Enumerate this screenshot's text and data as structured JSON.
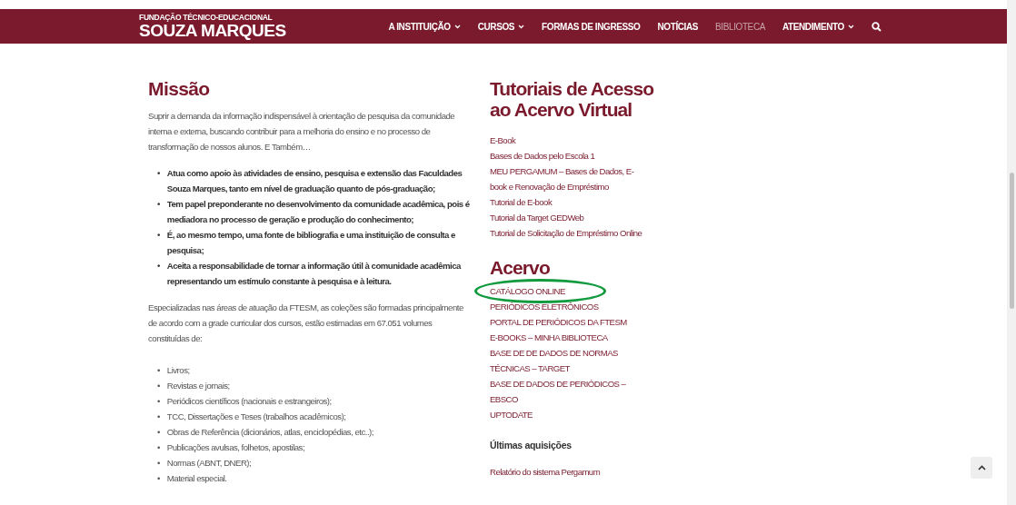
{
  "header": {
    "logo_small": "FUNDAÇÃO TÉCNICO-EDUCACIONAL",
    "logo_big": "SOUZA MARQUES",
    "nav": [
      {
        "label": "A INSTITUIÇÃO",
        "dropdown": true,
        "selected": false
      },
      {
        "label": "CURSOS",
        "dropdown": true,
        "selected": false
      },
      {
        "label": "FORMAS DE INGRESSO",
        "dropdown": false,
        "selected": false
      },
      {
        "label": "NOTÍCIAS",
        "dropdown": false,
        "selected": false
      },
      {
        "label": "BIBLIOTECA",
        "dropdown": false,
        "selected": true
      },
      {
        "label": "ATENDIMENTO",
        "dropdown": true,
        "selected": false
      }
    ]
  },
  "mission": {
    "title": "Missão",
    "bullet": "•",
    "intro": "Suprir a demanda da informação indispensável à orientação de pesquisa da comunidade interna e externa, buscando contribuir para a melhoria do ensino e no processo de transformação de nossos alunos. E Também…",
    "points": [
      "Atua como apoio às atividades de ensino, pesquisa e extensão das Faculdades Souza Marques, tanto em nível de graduação quanto de pós-graduação;",
      "Tem papel preponderante no desenvolvimento da comunidade acadêmica, pois é mediadora no processo de geração e produção do conhecimento;",
      "É, ao mesmo tempo, uma fonte de bibliografia e uma instituição de consulta e pesquisa;",
      "Aceita a responsabilidade de tornar a informação útil à comunidade acadêmica representando um estímulo constante à pesquisa e à leitura."
    ],
    "collection_text": "Especializadas nas áreas de atuação da FTESM, as coleções são formadas principalmente de acordo com a grade curricular dos cursos, estão estimadas em 67.051 volumes constituídas de:",
    "collection_items": [
      "Livros;",
      "Revistas e jornais;",
      "Periódicos científicos (nacionais e estrangeiros);",
      "TCC, Dissertações e Teses (trabalhos acadêmicos);",
      "Obras de Referência (dicionários, atlas, enciclopédias, etc..);",
      "Publicações avulsas, folhetos, apostilas;",
      "Normas (ABNT, DNER);",
      "Material especial."
    ]
  },
  "tutorials": {
    "title": "Tutoriais de Acesso ao Acervo Virtual",
    "links": [
      "E-Book",
      "Bases de Dados pelo Escola 1",
      "MEU PERGAMUM – Bases de Dados, E-book e Renovação de Empréstimo",
      "Tutorial de E-book",
      "Tutorial da Target GEDWeb",
      "Tutorial de Solicitação de Empréstimo Online"
    ]
  },
  "acervo": {
    "title": "Acervo",
    "links": [
      {
        "label": "CATÁLOGO ONLINE",
        "circled": true
      },
      {
        "label": "PERIÓDICOS ELETRÔNICOS",
        "circled": false
      },
      {
        "label": "PORTAL DE PERIÓDICOS DA FTESM",
        "circled": false
      },
      {
        "label": "E-BOOKS – MINHA BIBLIOTECA",
        "circled": false
      },
      {
        "label": "BASE DE DE DADOS DE NORMAS TÉCNICAS – TARGET",
        "circled": false
      },
      {
        "label": "BASE DE DADOS DE PERIÓDICOS – EBSCO",
        "circled": false
      },
      {
        "label": "UPTODATE",
        "circled": false
      }
    ]
  },
  "acquisitions": {
    "title": "Últimas aquisições",
    "links": [
      "Relatório do sistema Pergamum"
    ]
  }
}
